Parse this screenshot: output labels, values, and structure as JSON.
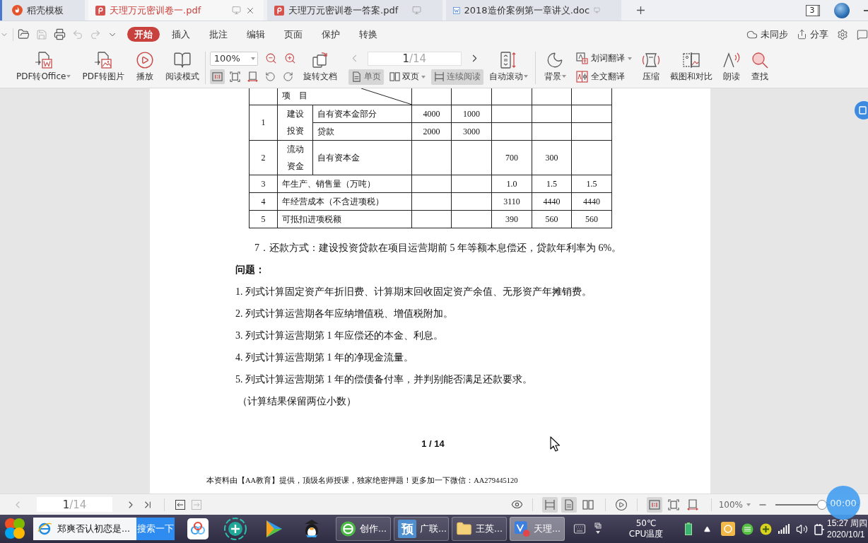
{
  "tabs": [
    {
      "label": "稻壳模板",
      "kind": "docer",
      "selected": false
    },
    {
      "label": "天理万元密训卷一.pdf",
      "kind": "pdf",
      "selected": true
    },
    {
      "label": "天理万元密训卷一答案.pdf",
      "kind": "pdf",
      "selected": false
    },
    {
      "label": "2018造价案例第一章讲义.doc",
      "kind": "doc",
      "selected": false
    }
  ],
  "window_count": "3",
  "menu": {
    "items": [
      {
        "label": "开始",
        "selected": true
      },
      {
        "label": "插入",
        "selected": false
      },
      {
        "label": "批注",
        "selected": false
      },
      {
        "label": "编辑",
        "selected": false
      },
      {
        "label": "页面",
        "selected": false
      },
      {
        "label": "保护",
        "selected": false
      },
      {
        "label": "转换",
        "selected": false
      }
    ],
    "sync": "未同步",
    "share": "分享"
  },
  "toolbar": {
    "convert": [
      {
        "label": "PDF转Office",
        "kind": "office",
        "dropdown": true
      },
      {
        "label": "PDF转图片",
        "kind": "image",
        "dropdown": false
      },
      {
        "label": "播放",
        "kind": "play",
        "dropdown": false
      },
      {
        "label": "阅读模式",
        "kind": "book",
        "dropdown": false
      }
    ],
    "zoom": "100%",
    "view_tools": [
      {
        "kind": "actual-size",
        "selected": true
      },
      {
        "kind": "fit-page",
        "selected": false
      },
      {
        "kind": "fit-width",
        "selected": false
      },
      {
        "kind": "rotate-left",
        "selected": false
      },
      {
        "kind": "rotate-right",
        "selected": false
      }
    ],
    "rotate": "旋转文档",
    "page": {
      "current": "1",
      "total": "/14"
    },
    "layouts": [
      {
        "label": "单页",
        "kind": "single",
        "selected": true,
        "dropdown": false
      },
      {
        "label": "双页",
        "kind": "double",
        "selected": false,
        "dropdown": true
      },
      {
        "label": "连续阅读",
        "kind": "continuous",
        "selected": true,
        "dropdown": false
      }
    ],
    "auto_scroll": {
      "label": "自动滚动",
      "dropdown": true
    },
    "background": {
      "label": "背景",
      "dropdown": true
    },
    "translate": [
      {
        "label": "划词翻译",
        "kind": "word",
        "dropdown": true
      },
      {
        "label": "全文翻译",
        "kind": "full",
        "dropdown": false
      }
    ],
    "tools": [
      {
        "label": "压缩",
        "kind": "compress"
      },
      {
        "label": "截图和对比",
        "kind": "screenshot"
      },
      {
        "label": "朗读",
        "kind": "read-aloud"
      },
      {
        "label": "查找",
        "kind": "find"
      }
    ]
  },
  "document": {
    "table": {
      "header": "项　目",
      "rows": [
        {
          "kind": "group",
          "no": "1",
          "group": "建设投资",
          "lines": [
            {
              "item": "自有资本金部分",
              "column_4": "4000",
              "column_5": "1000"
            },
            {
              "item": "贷款",
              "column_4": "2000",
              "column_5": "3000"
            }
          ]
        },
        {
          "kind": "group",
          "no": "2",
          "group": "流动资金",
          "lines": [
            {
              "item": "自有资本金",
              "column_6": "700",
              "column_7": "300"
            }
          ]
        },
        {
          "kind": "single",
          "no": "3",
          "item": "年生产、销售量（万吨）",
          "column_6": "1.0",
          "column_7": "1.5",
          "column_8": "1.5"
        },
        {
          "kind": "single",
          "no": "4",
          "item": "年经营成本（不含进项税）",
          "column_6": "3110",
          "column_7": "4440",
          "column_8": "4440"
        },
        {
          "kind": "single",
          "no": "5",
          "item": "可抵扣进项税额",
          "column_6": "390",
          "column_7": "560",
          "column_8": "560"
        }
      ]
    },
    "repayment": "7．还款方式：建设投资贷款在项目运营期前 5 年等额本息偿还，贷款年利率为 6%。",
    "questions_heading": "问题：",
    "questions": [
      "1. 列式计算固定资产年折旧费、计算期末回收固定资产余值、无形资产年摊销费。",
      "2. 列式计算运营期各年应纳增值税、增值税附加。",
      "3. 列式计算运营期第 1 年应偿还的本金、利息。",
      "4. 列式计算运营期第 1 年的净现金流量。",
      "5. 列式计算运营期第 1 年的偿债备付率，并判别能否满足还款要求。"
    ],
    "note": "（计算结果保留两位小数）",
    "page_number": "1 / 14",
    "footer": "本资料由【AA教育】提供，顶级名师授课，独家绝密押题！更多加一下微信：AA279445120"
  },
  "status_bar": {
    "page": {
      "current": "1",
      "total": "/14"
    },
    "layouts": [
      {
        "kind": "continuous",
        "selected": true
      },
      {
        "kind": "single",
        "selected": true
      },
      {
        "kind": "double",
        "selected": false
      }
    ],
    "view_tools": [
      {
        "kind": "actual-size",
        "selected": true
      },
      {
        "kind": "fit-page",
        "selected": false
      },
      {
        "kind": "fit-width",
        "selected": false
      }
    ],
    "zoom": "100%",
    "zoom_slider": {
      "level": 0.56
    }
  },
  "timer": "00:00",
  "taskbar": {
    "search": {
      "value": "郑爽否认初恋是...",
      "button": "搜索一下"
    },
    "tasks": [
      {
        "label": "创作...",
        "kind": "logo",
        "selected": false
      },
      {
        "label": "广联...",
        "kind": "tile",
        "icon_text": "预",
        "selected": false
      },
      {
        "label": "王英...",
        "kind": "folder",
        "selected": false
      },
      {
        "label": "天理...",
        "kind": "app",
        "selected": true
      }
    ],
    "temperature": "50℃",
    "temperature_label": "CPU温度",
    "time": "15:27 周四",
    "date": "2020/10/1"
  }
}
